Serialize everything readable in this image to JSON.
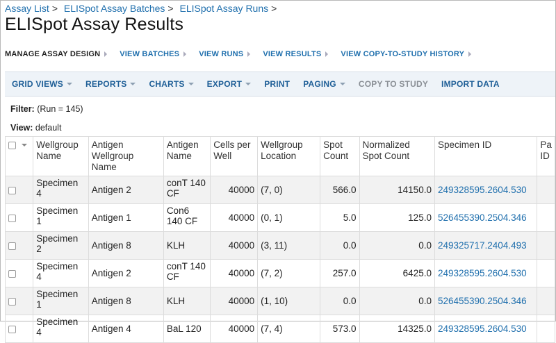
{
  "breadcrumb": {
    "items": [
      "Assay List",
      "ELISpot Assay Batches",
      "ELISpot Assay Runs"
    ],
    "separator": ">"
  },
  "page_title": "ELISpot Assay Results",
  "assay_nav": {
    "items": [
      "MANAGE ASSAY DESIGN",
      "VIEW BATCHES",
      "VIEW RUNS",
      "VIEW RESULTS",
      "VIEW COPY-TO-STUDY HISTORY"
    ]
  },
  "toolbar": {
    "grid_views": "GRID VIEWS",
    "reports": "REPORTS",
    "charts": "CHARTS",
    "export": "EXPORT",
    "print": "PRINT",
    "paging": "PAGING",
    "copy_to_study": "COPY TO STUDY",
    "import_data": "IMPORT DATA"
  },
  "filter": {
    "label": "Filter:",
    "value": "(Run = 145)"
  },
  "view": {
    "label": "View:",
    "value": "default"
  },
  "table": {
    "columns": [
      "Wellgroup Name",
      "Antigen Wellgroup Name",
      "Antigen Name",
      "Cells per Well",
      "Wellgroup Location",
      "Spot Count",
      "Normalized Spot Count",
      "Specimen ID",
      "Pa ID"
    ],
    "rows": [
      [
        "Specimen 4",
        "Antigen 2",
        "conT 140 CF",
        "40000",
        "(7, 0)",
        "566.0",
        "14150.0",
        "249328595.2604.530"
      ],
      [
        "Specimen 1",
        "Antigen 1",
        "Con6 140 CF",
        "40000",
        "(0, 1)",
        "5.0",
        "125.0",
        "526455390.2504.346"
      ],
      [
        "Specimen 2",
        "Antigen 8",
        "KLH",
        "40000",
        "(3, 11)",
        "0.0",
        "0.0",
        "249325717.2404.493"
      ],
      [
        "Specimen 4",
        "Antigen 2",
        "conT 140 CF",
        "40000",
        "(7, 2)",
        "257.0",
        "6425.0",
        "249328595.2604.530"
      ],
      [
        "Specimen 1",
        "Antigen 8",
        "KLH",
        "40000",
        "(1, 10)",
        "0.0",
        "0.0",
        "526455390.2504.346"
      ],
      [
        "Specimen 4",
        "Antigen 4",
        "BaL 120",
        "40000",
        "(7, 4)",
        "573.0",
        "14325.0",
        "249328595.2604.530"
      ]
    ]
  }
}
